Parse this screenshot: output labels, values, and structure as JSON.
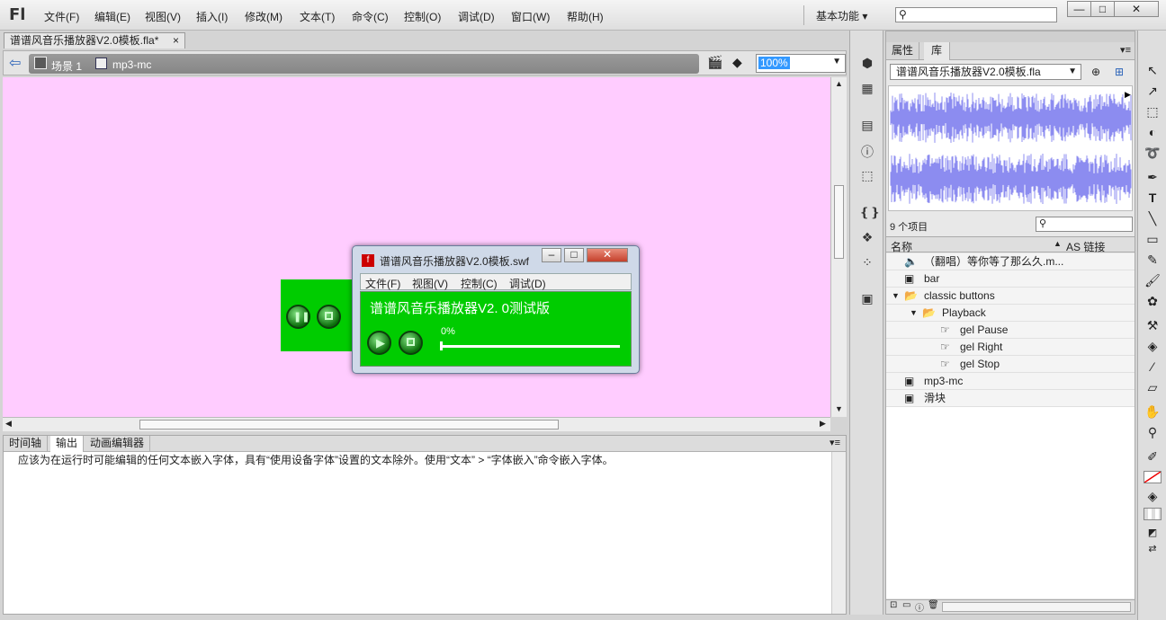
{
  "app": {
    "logo": "Fl",
    "workspace": "基本功能"
  },
  "menu": [
    "文件(F)",
    "编辑(E)",
    "视图(V)",
    "插入(I)",
    "修改(M)",
    "文本(T)",
    "命令(C)",
    "控制(O)",
    "调试(D)",
    "窗口(W)",
    "帮助(H)"
  ],
  "window_controls": {
    "minimize": "—",
    "maximize": "□",
    "close": "✕"
  },
  "doc": {
    "tab": "谱谱风音乐播放器V2.0模板.fla*",
    "close": "×"
  },
  "editbar": {
    "scene": "场景 1",
    "symbol": "mp3-mc",
    "zoom": "100%"
  },
  "bottom_panel": {
    "tabs": [
      "时间轴",
      "输出",
      "动画编辑器"
    ],
    "output": "应该为在运行时可能编辑的任何文本嵌入字体，具有“使用设备字体”设置的文本除外。使用“文本” > “字体嵌入”命令嵌入字体。"
  },
  "library": {
    "tabs": [
      "属性",
      "库"
    ],
    "doc_select": "谱谱风音乐播放器V2.0模板.fla",
    "count": "9 个项目",
    "col_name": "名称",
    "col_linkage": "AS 链接",
    "items": [
      {
        "label": "（翻唱）等你等了那么久.m...",
        "icon": "sound-icon",
        "level": 0
      },
      {
        "label": "bar",
        "icon": "movieclip-icon",
        "level": 0
      },
      {
        "label": "classic buttons",
        "icon": "folder-icon",
        "level": 0
      },
      {
        "label": "Playback",
        "icon": "folder-icon",
        "level": 1
      },
      {
        "label": "gel Pause",
        "icon": "button-symbol-icon",
        "level": 2
      },
      {
        "label": "gel Right",
        "icon": "button-symbol-icon",
        "level": 2
      },
      {
        "label": "gel Stop",
        "icon": "button-symbol-icon",
        "level": 2
      },
      {
        "label": "mp3-mc",
        "icon": "movieclip-icon",
        "level": 0
      },
      {
        "label": "滑块",
        "icon": "movieclip-icon",
        "level": 0
      }
    ]
  },
  "swf_window": {
    "title": "谱谱风音乐播放器V2.0模板.swf",
    "menu": [
      "文件(F)",
      "视图(V)",
      "控制(C)",
      "调试(D)"
    ],
    "player_title": "谱谱风音乐播放器V2. 0测试版",
    "progress_label": "0%",
    "progress": 0
  },
  "colors": {
    "stage": "#ffccff",
    "player_green": "#00cc00"
  }
}
